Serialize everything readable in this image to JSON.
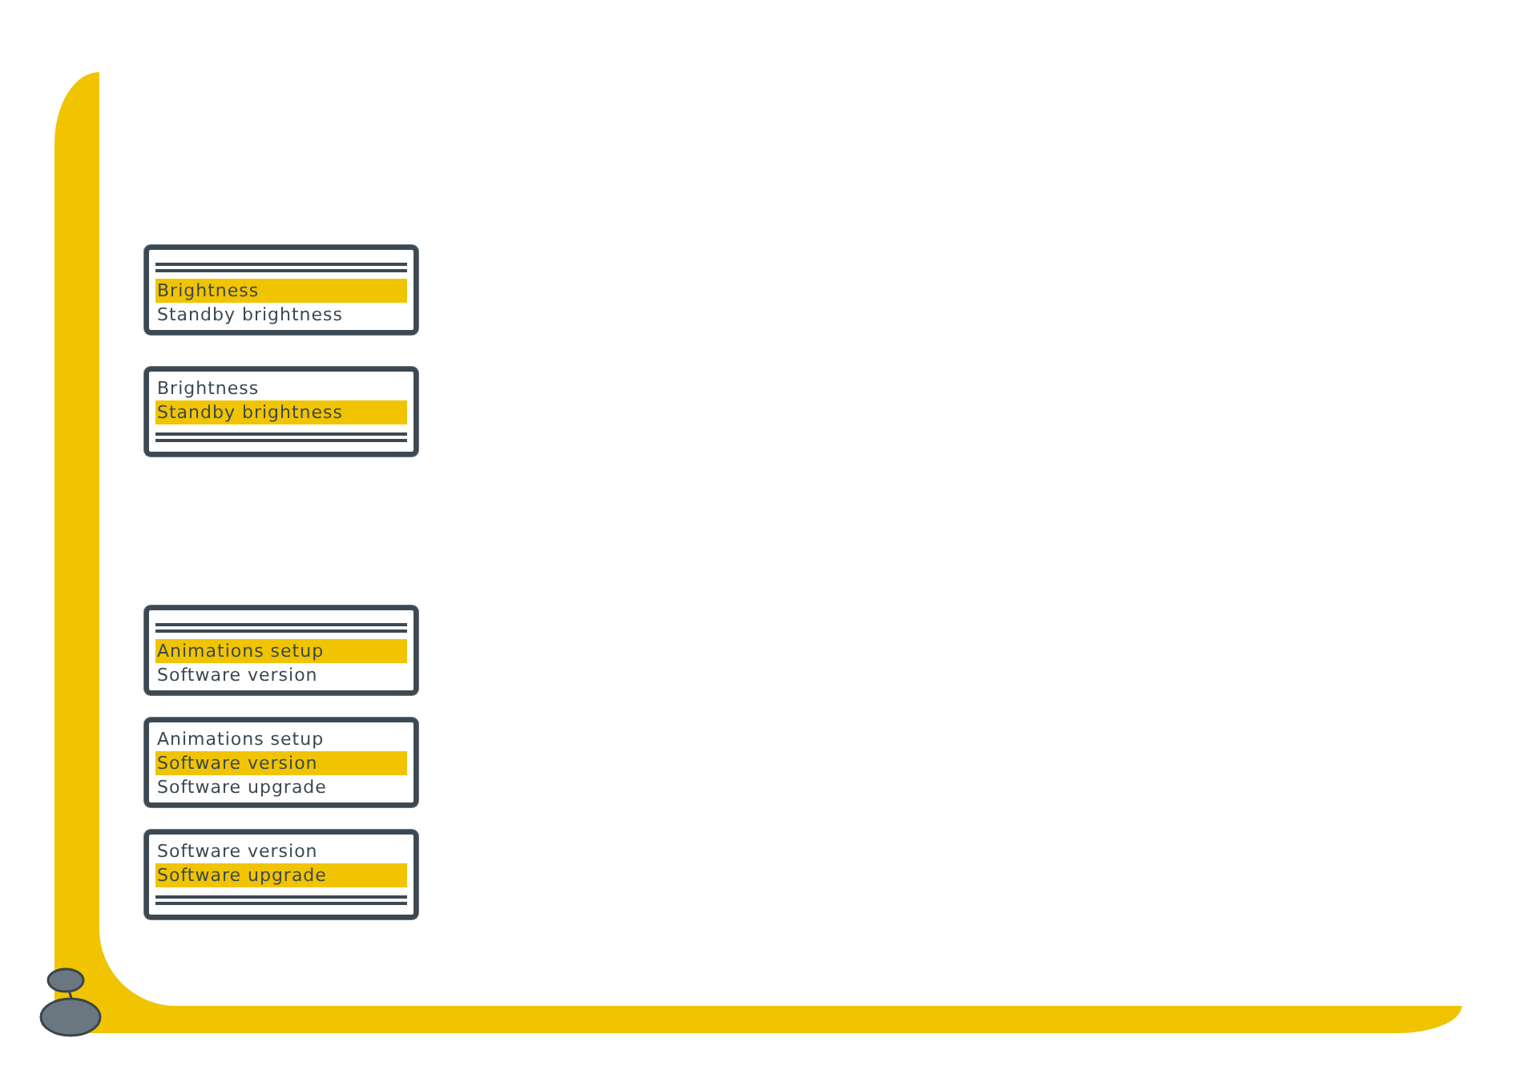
{
  "sections": [
    {
      "screens": [
        {
          "rows": [
            {
              "kind": "rule"
            },
            {
              "kind": "item",
              "label": "Brightness",
              "selected": true
            },
            {
              "kind": "item",
              "label": "Standby brightness",
              "selected": false
            }
          ]
        },
        {
          "rows": [
            {
              "kind": "item",
              "label": "Brightness",
              "selected": false
            },
            {
              "kind": "item",
              "label": "Standby brightness",
              "selected": true
            },
            {
              "kind": "rule"
            }
          ]
        }
      ]
    },
    {
      "screens": [
        {
          "rows": [
            {
              "kind": "rule"
            },
            {
              "kind": "item",
              "label": "Animations setup",
              "selected": true
            },
            {
              "kind": "item",
              "label": "Software version",
              "selected": false
            }
          ]
        },
        {
          "rows": [
            {
              "kind": "item",
              "label": "Animations setup",
              "selected": false
            },
            {
              "kind": "item",
              "label": "Software version",
              "selected": true
            },
            {
              "kind": "item",
              "label": "Software upgrade",
              "selected": false
            }
          ]
        },
        {
          "rows": [
            {
              "kind": "item",
              "label": "Software version",
              "selected": false
            },
            {
              "kind": "item",
              "label": "Software upgrade",
              "selected": true
            },
            {
              "kind": "rule"
            }
          ]
        }
      ]
    }
  ]
}
